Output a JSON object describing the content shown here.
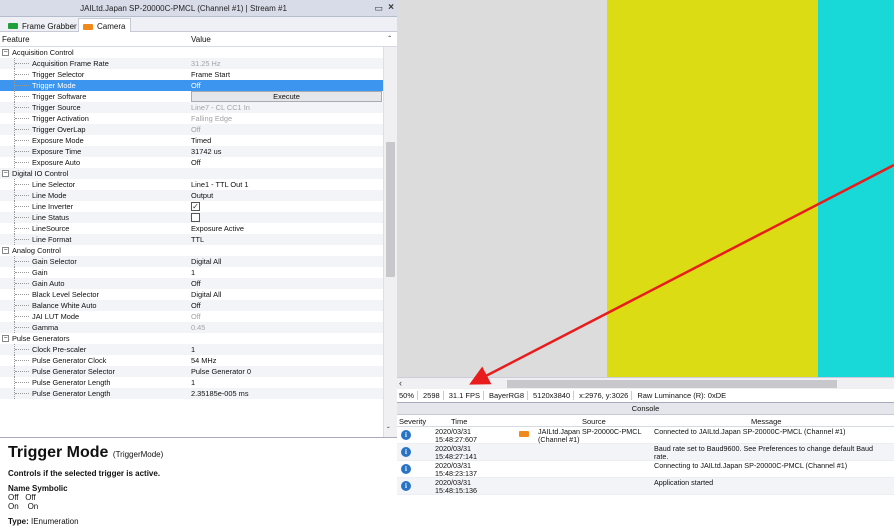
{
  "window": {
    "title": "JAILtd.Japan SP-20000C-PMCL (Channel #1) | Stream #1",
    "pin_icon": "pin-icon",
    "close_icon": "close-icon"
  },
  "tabs": [
    {
      "label": "Frame Grabber",
      "icon": "frame-grabber-icon",
      "color": "#1fa03a",
      "active": false
    },
    {
      "label": "Camera",
      "icon": "camera-icon",
      "color": "#f08a1c",
      "active": true
    }
  ],
  "columns": {
    "feature": "Feature",
    "value": "Value"
  },
  "features": [
    {
      "name": "Acquisition Control",
      "group": true
    },
    {
      "name": "Acquisition Frame Rate",
      "value": "31.25 Hz",
      "disabled": true
    },
    {
      "name": "Trigger Selector",
      "value": "Frame Start"
    },
    {
      "name": "Trigger Mode",
      "value": "Off",
      "selected": true
    },
    {
      "name": "Trigger Software",
      "button": "Execute"
    },
    {
      "name": "Trigger Source",
      "value": "Line7 - CL CC1 In",
      "disabled": true
    },
    {
      "name": "Trigger Activation",
      "value": "Falling Edge",
      "disabled": true
    },
    {
      "name": "Trigger OverLap",
      "value": "Off",
      "disabled": true
    },
    {
      "name": "Exposure Mode",
      "value": "Timed"
    },
    {
      "name": "Exposure Time",
      "value": "31742 us"
    },
    {
      "name": "Exposure Auto",
      "value": "Off"
    },
    {
      "name": "Digital IO Control",
      "group": true
    },
    {
      "name": "Line Selector",
      "value": "Line1 - TTL Out 1"
    },
    {
      "name": "Line Mode",
      "value": "Output"
    },
    {
      "name": "Line Inverter",
      "checkbox": true,
      "checked": true
    },
    {
      "name": "Line Status",
      "checkbox": true,
      "checked": false
    },
    {
      "name": "LineSource",
      "value": "Exposure Active"
    },
    {
      "name": "Line Format",
      "value": "TTL"
    },
    {
      "name": "Analog Control",
      "group": true
    },
    {
      "name": "Gain Selector",
      "value": "Digital All"
    },
    {
      "name": "Gain",
      "value": "1"
    },
    {
      "name": "Gain Auto",
      "value": "Off"
    },
    {
      "name": "Black Level Selector",
      "value": "Digital All"
    },
    {
      "name": "Balance White Auto",
      "value": "Off"
    },
    {
      "name": "JAI LUT Mode",
      "value": "Off",
      "disabled": true
    },
    {
      "name": "Gamma",
      "value": "0.45",
      "disabled": true
    },
    {
      "name": "Pulse Generators",
      "group": true
    },
    {
      "name": "Clock Pre-scaler",
      "value": "1"
    },
    {
      "name": "Pulse Generator Clock",
      "value": "54 MHz"
    },
    {
      "name": "Pulse Generator Selector",
      "value": "Pulse Generator 0"
    },
    {
      "name": "Pulse Generator Length",
      "value": "1"
    },
    {
      "name": "Pulse Generator Length",
      "value": "2.35185e-005 ms"
    }
  ],
  "description": {
    "title": "Trigger Mode",
    "symbolic": "(TriggerMode)",
    "text": "Controls if the selected trigger is active.",
    "header_name": "Name",
    "header_symbolic": "Symbolic",
    "entries": [
      {
        "name": "Off",
        "symbolic": "Off"
      },
      {
        "name": "On",
        "symbolic": "On"
      }
    ],
    "type_label": "Type:",
    "type_value": "IEnumeration"
  },
  "viewer": {
    "colors": [
      "#dcdcdc",
      "#dcdc14",
      "#18d8d8"
    ]
  },
  "status": {
    "zoom": "50%",
    "frame": "2598",
    "fps": "31.1 FPS",
    "format": "BayerRG8",
    "size": "5120x3840",
    "coords": "x:2976, y:3026",
    "raw": "Raw Luminance (R): 0xDE"
  },
  "console": {
    "title": "Console",
    "columns": {
      "severity": "Severity",
      "time": "Time",
      "source": "Source",
      "message": "Message"
    },
    "rows": [
      {
        "date": "2020/03/31",
        "time": "15:48:27:607",
        "source": "JAILtd.Japan SP-20000C-PMCL (Channel #1)",
        "message": "Connected to JAILtd.Japan SP-20000C-PMCL (Channel #1)",
        "camera_icon": true
      },
      {
        "date": "2020/03/31",
        "time": "15:48:27:141",
        "source": "",
        "message": "Baud rate set to Baud9600. See Preferences to change default Baud rate."
      },
      {
        "date": "2020/03/31",
        "time": "15:48:23:137",
        "source": "",
        "message": "Connecting to JAILtd.Japan SP-20000C-PMCL (Channel #1)"
      },
      {
        "date": "2020/03/31",
        "time": "15:48:15:136",
        "source": "",
        "message": "Application started"
      }
    ]
  },
  "annotation": {
    "color": "#e81c1c"
  }
}
